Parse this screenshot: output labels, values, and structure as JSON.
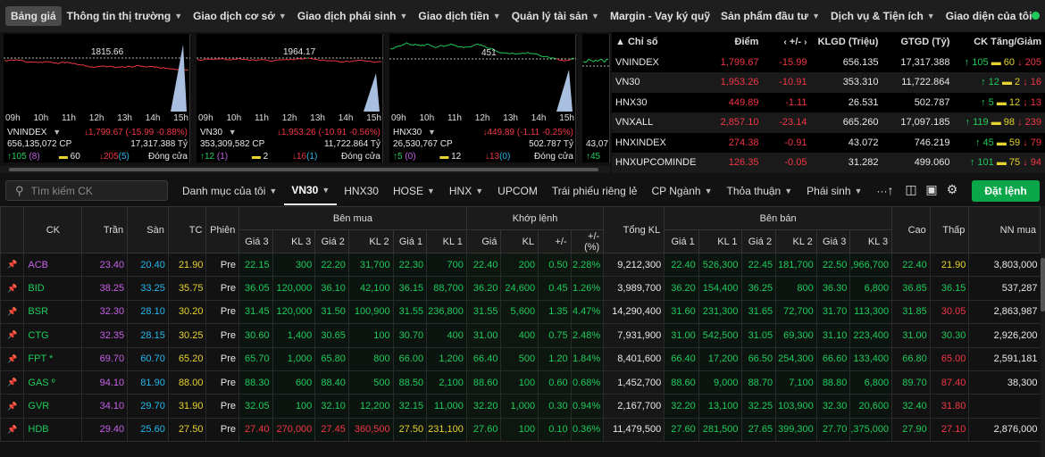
{
  "nav": {
    "items": [
      {
        "label": "Bảng giá",
        "active": true,
        "dropdown": false
      },
      {
        "label": "Thông tin thị trường",
        "dropdown": true
      },
      {
        "label": "Giao dịch cơ sở",
        "dropdown": true
      },
      {
        "label": "Giao dịch phái sinh",
        "dropdown": true
      },
      {
        "label": "Giao dịch tiền",
        "dropdown": true
      },
      {
        "label": "Quản lý tài sản",
        "dropdown": true
      },
      {
        "label": "Margin - Vay ký quỹ",
        "dropdown": false
      },
      {
        "label": "Sản phẩm đầu tư",
        "dropdown": true
      },
      {
        "label": "Dịch vụ & Tiện ích",
        "dropdown": true
      },
      {
        "label": "Giao diện của tôi",
        "dropdown": false
      }
    ],
    "status_color": "#1fcb5c"
  },
  "colors": {
    "up": "#1fcb5c",
    "down": "#f23645",
    "ref": "#e6d32f",
    "ceil": "#c65fe8",
    "floor": "#26b8ec"
  },
  "mini_charts": [
    {
      "ref_label": "1815.66",
      "name": "VNINDEX",
      "change": "↓1,799.67 (-15.99 -0.88%)",
      "volume": "656,135,072 CP",
      "value": "17,317.388 Tỷ",
      "up": "↑105",
      "up_ceil": "(8)",
      "ref": "60",
      "down": "↓205",
      "down_floor": "(5)",
      "status": "Đóng cửa",
      "ticks": [
        "09h",
        "10h",
        "11h",
        "12h",
        "13h",
        "14h",
        "15h"
      ]
    },
    {
      "ref_label": "1964.17",
      "name": "VN30",
      "change": "↓1,953.26 (-10.91 -0.56%)",
      "volume": "353,309,582 CP",
      "value": "11,722.864 Tỷ",
      "up": "↑12",
      "up_ceil": "(1)",
      "ref": "2",
      "down": "↓16",
      "down_floor": "(1)",
      "status": "Đóng cửa",
      "ticks": [
        "09h",
        "10h",
        "11h",
        "12h",
        "13h",
        "14h",
        "15h"
      ]
    },
    {
      "ref_label": "451",
      "name": "HNX30",
      "change": "↓449.89 (-1.11 -0.25%)",
      "volume": "26,530,767 CP",
      "value": "502.787 Tỷ",
      "up": "↑5",
      "up_ceil": "(0)",
      "ref": "12",
      "down": "↓13",
      "down_floor": "(0)",
      "status": "Đóng cửa",
      "ticks": [
        "09h",
        "10h",
        "11h",
        "12h",
        "13h",
        "14h",
        "15h"
      ]
    },
    {
      "ref_label": "",
      "name": "VNXALL",
      "change": "",
      "volume": "43,07",
      "value": "",
      "up": "↑45",
      "up_ceil": "",
      "ref": "",
      "down": "",
      "down_floor": "",
      "status": "",
      "ticks": []
    }
  ],
  "index_table": {
    "headers": {
      "name": "Chỉ số",
      "point": "Điểm",
      "change": "+/-",
      "klgd": "KLGD (Triệu)",
      "gtgd": "GTGD (Tỷ)",
      "ck": "CK Tăng/Giảm"
    },
    "rows": [
      {
        "name": "VNINDEX",
        "point": "1,799.67",
        "change": "-15.99",
        "klgd": "656.135",
        "gtgd": "17,317.388",
        "up": "↑ 105",
        "ref": "60",
        "down": "↓ 205"
      },
      {
        "name": "VN30",
        "point": "1,953.26",
        "change": "-10.91",
        "klgd": "353.310",
        "gtgd": "11,722.864",
        "up": "↑ 12",
        "ref": "2",
        "down": "↓ 16"
      },
      {
        "name": "HNX30",
        "point": "449.89",
        "change": "-1.11",
        "klgd": "26.531",
        "gtgd": "502.787",
        "up": "↑ 5",
        "ref": "12",
        "down": "↓ 13"
      },
      {
        "name": "VNXALL",
        "point": "2,857.10",
        "change": "-23.14",
        "klgd": "665.260",
        "gtgd": "17,097.185",
        "up": "↑ 119",
        "ref": "98",
        "down": "↓ 239"
      },
      {
        "name": "HNXINDEX",
        "point": "274.38",
        "change": "-0.91",
        "klgd": "43.072",
        "gtgd": "746.219",
        "up": "↑ 45",
        "ref": "59",
        "down": "↓ 79"
      },
      {
        "name": "HNXUPCOMINDE",
        "point": "126.35",
        "change": "-0.05",
        "klgd": "31.282",
        "gtgd": "499.060",
        "up": "↑ 101",
        "ref": "75",
        "down": "↓ 94"
      }
    ]
  },
  "toolbar": {
    "search_placeholder": "Tìm kiếm CK",
    "tabs": [
      {
        "label": "Danh mục của tôi",
        "dropdown": true
      },
      {
        "label": "VN30",
        "dropdown": true,
        "active": true
      },
      {
        "label": "HNX30",
        "dropdown": false
      },
      {
        "label": "HOSE",
        "dropdown": true
      },
      {
        "label": "HNX",
        "dropdown": true
      },
      {
        "label": "UPCOM",
        "dropdown": false
      },
      {
        "label": "Trái phiếu riêng lẻ",
        "dropdown": false
      },
      {
        "label": "CP Ngành",
        "dropdown": true
      },
      {
        "label": "Thỏa thuận",
        "dropdown": true
      },
      {
        "label": "Phái sinh",
        "dropdown": true
      },
      {
        "label": "···",
        "dropdown": false
      }
    ],
    "order_label": "Đặt lệnh"
  },
  "board": {
    "headers": {
      "ck": "CK",
      "tran": "Trần",
      "san": "Sàn",
      "tc": "TC",
      "phien": "Phiên",
      "buy_group": "Bên mua",
      "match_group": "Khớp lệnh",
      "total": "Tổng KL",
      "sell_group": "Bên bán",
      "high": "Cao",
      "low": "Thấp",
      "nn": "NN mua",
      "buy_cols": [
        "Giá 3",
        "KL 3",
        "Giá 2",
        "KL 2",
        "Giá 1",
        "KL 1"
      ],
      "match_cols": [
        "Giá",
        "KL",
        "+/-",
        "+/- (%)"
      ],
      "sell_cols": [
        "Giá 1",
        "KL 1",
        "Giá 2",
        "KL 2",
        "Giá 3",
        "KL 3"
      ]
    },
    "rows": [
      {
        "ck": "ACB",
        "c": "ceil",
        "tran": "23.40",
        "san": "20.40",
        "tc": "21.90",
        "phien": "Pre",
        "b3": [
          "22.15",
          "up"
        ],
        "bk3": "300",
        "b2": [
          "22.20",
          "up"
        ],
        "bk2": "31,700",
        "b1": [
          "22.30",
          "up"
        ],
        "bk1": "700",
        "m": [
          "22.40",
          "up"
        ],
        "mk": "200",
        "md": "0.50",
        "mp": "2.28%",
        "tot": "9,212,300",
        "s1": [
          "22.40",
          "up"
        ],
        "sk1": "526,300",
        "s2": [
          "22.45",
          "up"
        ],
        "sk2": "181,700",
        "s3": [
          "22.50",
          "up"
        ],
        "sk3": ",966,700",
        "hi": [
          "22.40",
          "up"
        ],
        "lo": [
          "21.90",
          "ref"
        ],
        "nn": "3,803,000"
      },
      {
        "ck": "BID",
        "c": "up",
        "tran": "38.25",
        "san": "33.25",
        "tc": "35.75",
        "phien": "Pre",
        "b3": [
          "36.05",
          "up"
        ],
        "bk3": "120,000",
        "b2": [
          "36.10",
          "up"
        ],
        "bk2": "42,100",
        "b1": [
          "36.15",
          "up"
        ],
        "bk1": "88,700",
        "m": [
          "36.20",
          "up"
        ],
        "mk": "24,600",
        "md": "0.45",
        "mp": "1.26%",
        "tot": "3,989,700",
        "s1": [
          "36.20",
          "up"
        ],
        "sk1": "154,400",
        "s2": [
          "36.25",
          "up"
        ],
        "sk2": "800",
        "s3": [
          "36.30",
          "up"
        ],
        "sk3": "6,800",
        "hi": [
          "36.85",
          "up"
        ],
        "lo": [
          "36.15",
          "up"
        ],
        "nn": "537,287"
      },
      {
        "ck": "BSR",
        "c": "up",
        "tran": "32.30",
        "san": "28.10",
        "tc": "30.20",
        "phien": "Pre",
        "b3": [
          "31.45",
          "up"
        ],
        "bk3": "120,000",
        "b2": [
          "31.50",
          "up"
        ],
        "bk2": "100,900",
        "b1": [
          "31.55",
          "up"
        ],
        "bk1": "236,800",
        "m": [
          "31.55",
          "up"
        ],
        "mk": "5,600",
        "md": "1.35",
        "mp": "4.47%",
        "tot": "14,290,400",
        "s1": [
          "31.60",
          "up"
        ],
        "sk1": "231,300",
        "s2": [
          "31.65",
          "up"
        ],
        "sk2": "72,700",
        "s3": [
          "31.70",
          "up"
        ],
        "sk3": "113,300",
        "hi": [
          "31.85",
          "up"
        ],
        "lo": [
          "30.05",
          "down"
        ],
        "nn": "2,863,987"
      },
      {
        "ck": "CTG",
        "c": "up",
        "tran": "32.35",
        "san": "28.15",
        "tc": "30.25",
        "phien": "Pre",
        "b3": [
          "30.60",
          "up"
        ],
        "bk3": "1,400",
        "b2": [
          "30.65",
          "up"
        ],
        "bk2": "100",
        "b1": [
          "30.70",
          "up"
        ],
        "bk1": "400",
        "m": [
          "31.00",
          "up"
        ],
        "mk": "400",
        "md": "0.75",
        "mp": "2.48%",
        "tot": "7,931,900",
        "s1": [
          "31.00",
          "up"
        ],
        "sk1": "542,500",
        "s2": [
          "31.05",
          "up"
        ],
        "sk2": "69,300",
        "s3": [
          "31.10",
          "up"
        ],
        "sk3": "223,400",
        "hi": [
          "31.00",
          "up"
        ],
        "lo": [
          "30.30",
          "up"
        ],
        "nn": "2,926,200"
      },
      {
        "ck": "FPT *",
        "c": "up",
        "tran": "69.70",
        "san": "60.70",
        "tc": "65.20",
        "phien": "Pre",
        "b3": [
          "65.70",
          "up"
        ],
        "bk3": "1,000",
        "b2": [
          "65.80",
          "up"
        ],
        "bk2": "800",
        "b1": [
          "66.00",
          "up"
        ],
        "bk1": "1,200",
        "m": [
          "66.40",
          "up"
        ],
        "mk": "500",
        "md": "1.20",
        "mp": "1.84%",
        "tot": "8,401,600",
        "s1": [
          "66.40",
          "up"
        ],
        "sk1": "17,200",
        "s2": [
          "66.50",
          "up"
        ],
        "sk2": "254,300",
        "s3": [
          "66.60",
          "up"
        ],
        "sk3": "133,400",
        "hi": [
          "66.80",
          "up"
        ],
        "lo": [
          "65.00",
          "down"
        ],
        "nn": "2,591,181"
      },
      {
        "ck": "GAS º",
        "c": "up",
        "tran": "94.10",
        "san": "81.90",
        "tc": "88.00",
        "phien": "Pre",
        "b3": [
          "88.30",
          "up"
        ],
        "bk3": "600",
        "b2": [
          "88.40",
          "up"
        ],
        "bk2": "500",
        "b1": [
          "88.50",
          "up"
        ],
        "bk1": "2,100",
        "m": [
          "88.60",
          "up"
        ],
        "mk": "100",
        "md": "0.60",
        "mp": "0.68%",
        "tot": "1,452,700",
        "s1": [
          "88.60",
          "up"
        ],
        "sk1": "9,000",
        "s2": [
          "88.70",
          "up"
        ],
        "sk2": "7,100",
        "s3": [
          "88.80",
          "up"
        ],
        "sk3": "6,800",
        "hi": [
          "89.70",
          "up"
        ],
        "lo": [
          "87.40",
          "down"
        ],
        "nn": "38,300"
      },
      {
        "ck": "GVR",
        "c": "up",
        "tran": "34.10",
        "san": "29.70",
        "tc": "31.90",
        "phien": "Pre",
        "b3": [
          "32.05",
          "up"
        ],
        "bk3": "100",
        "b2": [
          "32.10",
          "up"
        ],
        "bk2": "12,200",
        "b1": [
          "32.15",
          "up"
        ],
        "bk1": "11,000",
        "m": [
          "32.20",
          "up"
        ],
        "mk": "1,000",
        "md": "0.30",
        "mp": "0.94%",
        "tot": "2,167,700",
        "s1": [
          "32.20",
          "up"
        ],
        "sk1": "13,100",
        "s2": [
          "32.25",
          "up"
        ],
        "sk2": "103,900",
        "s3": [
          "32.30",
          "up"
        ],
        "sk3": "20,600",
        "hi": [
          "32.40",
          "up"
        ],
        "lo": [
          "31.80",
          "down"
        ],
        "nn": ""
      },
      {
        "ck": "HDB",
        "c": "up",
        "tran": "29.40",
        "san": "25.60",
        "tc": "27.50",
        "phien": "Pre",
        "b3": [
          "27.40",
          "down"
        ],
        "bk3": "270,000",
        "b2": [
          "27.45",
          "down"
        ],
        "bk2": "360,500",
        "b1": [
          "27.50",
          "ref"
        ],
        "bk1": "231,100",
        "m": [
          "27.60",
          "up"
        ],
        "mk": "100",
        "md": "0.10",
        "mp": "0.36%",
        "tot": "11,479,500",
        "s1": [
          "27.60",
          "up"
        ],
        "sk1": "281,500",
        "s2": [
          "27.65",
          "up"
        ],
        "sk2": "399,300",
        "s3": [
          "27.70",
          "up"
        ],
        "sk3": ",375,000",
        "hi": [
          "27.90",
          "up"
        ],
        "lo": [
          "27.10",
          "down"
        ],
        "nn": "2,876,000"
      }
    ]
  }
}
